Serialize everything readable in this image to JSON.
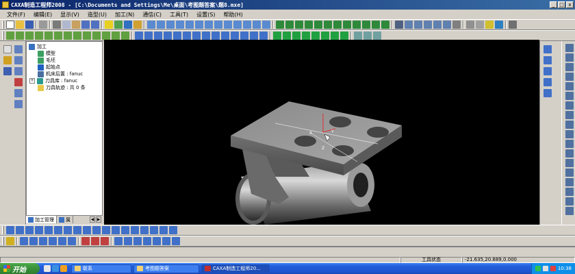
{
  "window": {
    "title": "CAXA制造工程师2008  - [C:\\Documents and Settings\\Me\\桌面\\考图题答案\\题8.mxe]",
    "controls": [
      "_",
      "□",
      "x"
    ]
  },
  "menu": [
    "文件(F)",
    "编辑(E)",
    "显示(V)",
    "造型(U)",
    "加工(N)",
    "通信(C)",
    "工具(T)",
    "设置(S)",
    "帮助(H)"
  ],
  "tree": {
    "root": "加工",
    "items": [
      "模型",
      "毛坯",
      "起始点",
      "机床后置 : fanuc",
      "刀具库 : fanuc",
      "刀具轨迹 : 共 0 条"
    ],
    "tabs": [
      "加工管理",
      "属"
    ]
  },
  "viewport": {
    "axis_labels": [
      "X",
      "Y",
      "Z"
    ]
  },
  "status": {
    "state": "工具状态",
    "coords": "-21.635,20.889,0.000"
  },
  "taskbar": {
    "start": "开始",
    "tasks": [
      "联系",
      "考图题答案",
      "CAXA制造工程师20..."
    ],
    "time": "10:38"
  },
  "colors": {
    "title_start": "#0a246a",
    "title_end": "#3a6ea5",
    "viewport_bg": "#000000",
    "chrome": "#d4d0c8",
    "taskbar": "#245edb"
  }
}
